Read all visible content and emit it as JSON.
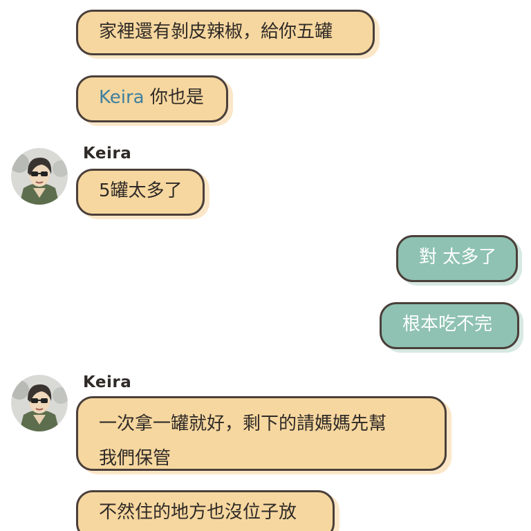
{
  "messages": [
    {
      "side": "left",
      "text": "家裡還有剝皮辣椒，給你五罐"
    },
    {
      "side": "left",
      "mention": "Keira",
      "text": " 你也是"
    },
    {
      "side": "left",
      "sender": "Keira",
      "avatar": "avatar-icon",
      "text": "5罐太多了"
    },
    {
      "side": "right",
      "text": "對 太多了"
    },
    {
      "side": "right",
      "text": "根本吃不完"
    },
    {
      "side": "left",
      "sender": "Keira",
      "avatar": "avatar-icon",
      "lines": [
        "一次拿一罐就好，剩下的請媽媽先幫",
        "我們保管"
      ]
    },
    {
      "side": "left",
      "text": "不然住的地方也沒位子放"
    }
  ],
  "colors": {
    "left_bubble": "#f6d79f",
    "right_bubble": "#8fc2b2",
    "outline": "#4a3f3a",
    "mention": "#3d7fa0"
  }
}
